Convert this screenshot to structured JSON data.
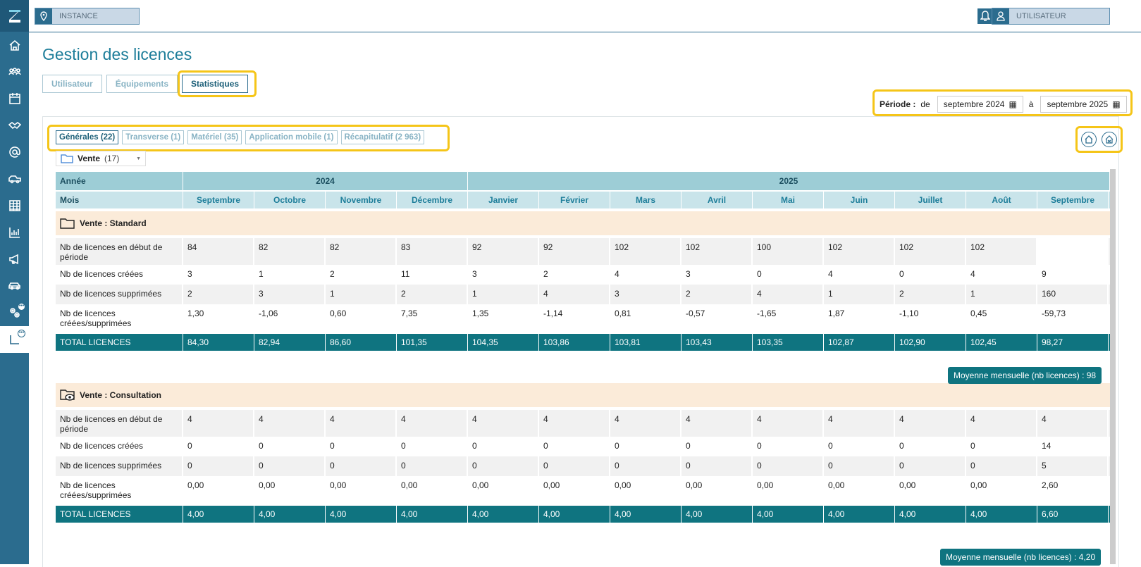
{
  "topbar": {
    "instance": "INSTANCE",
    "user": "UTILISATEUR"
  },
  "page_title": "Gestion des licences",
  "tabs": [
    "Utilisateur",
    "Équipements",
    "Statistiques"
  ],
  "periode": {
    "label": "Période :",
    "de": "de",
    "from": "septembre 2024",
    "a": "à",
    "to": "septembre 2025"
  },
  "subtabs": [
    "Générales (22)",
    "Transverse (1)",
    "Matériel (35)",
    "Application mobile (1)",
    "Récapitulatif (2 963)"
  ],
  "filter": {
    "label": "Vente",
    "count": "(17)"
  },
  "table": {
    "year_label": "Année",
    "years": [
      "2024",
      "2025"
    ],
    "month_label": "Mois",
    "months": [
      "Septembre",
      "Octobre",
      "Novembre",
      "Décembre",
      "Janvier",
      "Février",
      "Mars",
      "Avril",
      "Mai",
      "Juin",
      "Juillet",
      "Août",
      "Septembre"
    ],
    "sections": [
      {
        "title": "Vente : Standard",
        "rows": [
          {
            "label": "Nb de licences en début de période",
            "values": [
              "84",
              "82",
              "82",
              "83",
              "92",
              "92",
              "102",
              "102",
              "100",
              "102",
              "102",
              "102",
              ""
            ]
          },
          {
            "label": "Nb de licences créées",
            "values": [
              "3",
              "1",
              "2",
              "11",
              "3",
              "2",
              "4",
              "3",
              "0",
              "4",
              "0",
              "4",
              "9"
            ]
          },
          {
            "label": "Nb de licences supprimées",
            "values": [
              "2",
              "3",
              "1",
              "2",
              "1",
              "4",
              "3",
              "2",
              "4",
              "1",
              "2",
              "1",
              "160"
            ]
          },
          {
            "label": "Nb de licences créées/supprimées",
            "values": [
              "1,30",
              "-1,06",
              "0,60",
              "7,35",
              "1,35",
              "-1,14",
              "0,81",
              "-0,57",
              "-1,65",
              "1,87",
              "-1,10",
              "0,45",
              "-59,73"
            ]
          }
        ],
        "total_label": "TOTAL LICENCES",
        "totals": [
          "84,30",
          "82,94",
          "86,60",
          "101,35",
          "104,35",
          "103,86",
          "103,81",
          "103,43",
          "103,35",
          "102,87",
          "102,90",
          "102,45",
          "98,27"
        ],
        "average": "Moyenne mensuelle (nb licences) : 98"
      },
      {
        "title": "Vente : Consultation",
        "rows": [
          {
            "label": "Nb de licences en début de période",
            "values": [
              "4",
              "4",
              "4",
              "4",
              "4",
              "4",
              "4",
              "4",
              "4",
              "4",
              "4",
              "4",
              "4"
            ]
          },
          {
            "label": "Nb de licences créées",
            "values": [
              "0",
              "0",
              "0",
              "0",
              "0",
              "0",
              "0",
              "0",
              "0",
              "0",
              "0",
              "0",
              "14"
            ]
          },
          {
            "label": "Nb de licences supprimées",
            "values": [
              "0",
              "0",
              "0",
              "0",
              "0",
              "0",
              "0",
              "0",
              "0",
              "0",
              "0",
              "0",
              "5"
            ]
          },
          {
            "label": "Nb de licences créées/supprimées",
            "values": [
              "0,00",
              "0,00",
              "0,00",
              "0,00",
              "0,00",
              "0,00",
              "0,00",
              "0,00",
              "0,00",
              "0,00",
              "0,00",
              "0,00",
              "2,60"
            ]
          }
        ],
        "total_label": "TOTAL LICENCES",
        "totals": [
          "4,00",
          "4,00",
          "4,00",
          "4,00",
          "4,00",
          "4,00",
          "4,00",
          "4,00",
          "4,00",
          "4,00",
          "4,00",
          "4,00",
          "6,60"
        ],
        "average": "Moyenne mensuelle (nb licences) : 4,20"
      }
    ]
  },
  "colors": {
    "brand": "#2b6c8e",
    "teal": "#0f7480",
    "highlight": "#f5c518",
    "section_bg": "#fbebd9"
  },
  "sidebar_icons": [
    "home-icon",
    "groups-icon",
    "calendar-icon",
    "handshake-icon",
    "at-icon",
    "vehicles-icon",
    "table-icon",
    "stats-icon",
    "megaphone-icon",
    "car-icon",
    "settings-icon",
    "licences-icon"
  ]
}
